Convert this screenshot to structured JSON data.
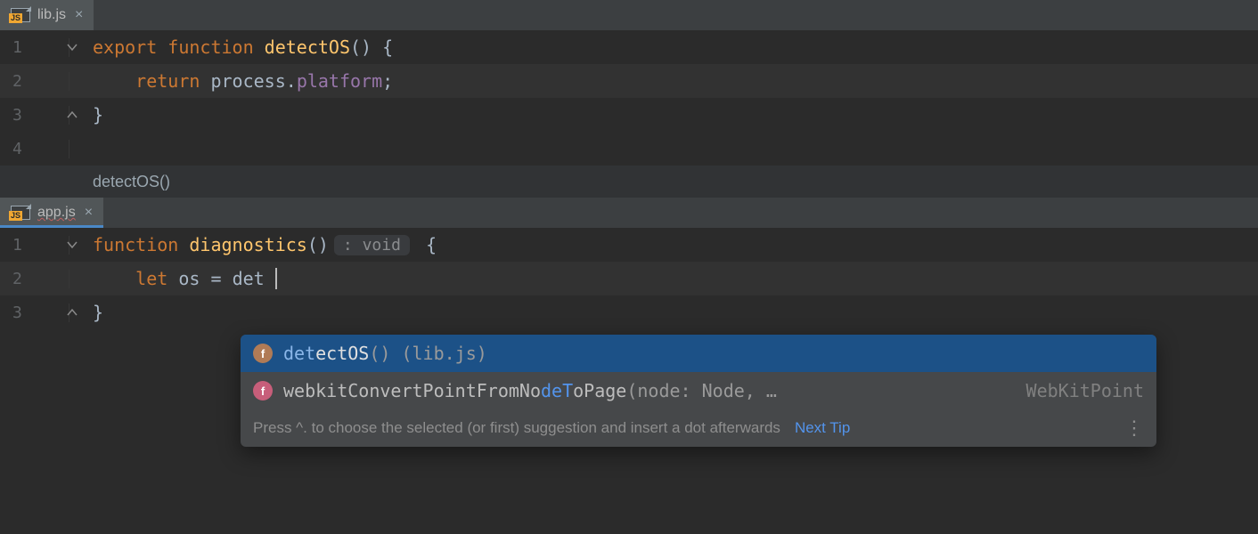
{
  "topPane": {
    "tab": {
      "filename": "lib.js"
    },
    "lines": [
      {
        "num": "1",
        "tokens": [
          {
            "cls": "kw",
            "t": "export"
          },
          {
            "cls": "punc",
            "t": " "
          },
          {
            "cls": "kw",
            "t": "function"
          },
          {
            "cls": "punc",
            "t": " "
          },
          {
            "cls": "fn",
            "t": "detectOS"
          },
          {
            "cls": "punc",
            "t": "()"
          },
          {
            "cls": "punc",
            "t": " "
          },
          {
            "cls": "punc",
            "t": "{"
          }
        ],
        "foldOpen": true
      },
      {
        "num": "2",
        "hl": true,
        "tokens": [
          {
            "cls": "punc",
            "t": "    "
          },
          {
            "cls": "kw",
            "t": "return"
          },
          {
            "cls": "punc",
            "t": " "
          },
          {
            "cls": "ident",
            "t": "process"
          },
          {
            "cls": "punc",
            "t": "."
          },
          {
            "cls": "prop",
            "t": "platform"
          },
          {
            "cls": "punc",
            "t": ";"
          }
        ]
      },
      {
        "num": "3",
        "tokens": [
          {
            "cls": "punc",
            "t": "}"
          }
        ],
        "foldClose": true
      },
      {
        "num": "4",
        "tokens": []
      }
    ],
    "breadcrumb": "detectOS()"
  },
  "bottomPane": {
    "tab": {
      "filename": "app.js"
    },
    "lines": [
      {
        "num": "1",
        "tokens": [
          {
            "cls": "kw",
            "t": "function"
          },
          {
            "cls": "punc",
            "t": " "
          },
          {
            "cls": "fn",
            "t": "diagnostics"
          },
          {
            "cls": "punc",
            "t": "()"
          },
          {
            "cls": "hint-box",
            "t": ": void"
          },
          {
            "cls": "punc",
            "t": " {"
          }
        ],
        "foldOpen": true
      },
      {
        "num": "2",
        "hl": true,
        "caret": true,
        "tokens": [
          {
            "cls": "punc",
            "t": "    "
          },
          {
            "cls": "kw",
            "t": "let"
          },
          {
            "cls": "punc",
            "t": " "
          },
          {
            "cls": "ident",
            "t": "os"
          },
          {
            "cls": "punc",
            "t": " = "
          },
          {
            "cls": "ident",
            "t": "det"
          }
        ]
      },
      {
        "num": "3",
        "tokens": [
          {
            "cls": "punc",
            "t": "}"
          }
        ],
        "foldClose": true
      }
    ]
  },
  "completion": {
    "items": [
      {
        "selected": true,
        "badge": "f",
        "badgeCls": "f-orange",
        "parts": [
          {
            "m": true,
            "t": "det"
          },
          {
            "m": false,
            "t": "ectOS"
          }
        ],
        "suffix": "()",
        "source": "(lib.js)",
        "tail": ""
      },
      {
        "selected": false,
        "badge": "f",
        "badgeCls": "f-pink",
        "parts": [
          {
            "m": false,
            "t": "webkitConvertPointFromNo"
          },
          {
            "m": true,
            "t": "deT"
          },
          {
            "m": false,
            "t": "oPage"
          }
        ],
        "suffix": "(node: Node, …",
        "source": "",
        "tail": "WebKitPoint"
      }
    ],
    "footerHint": "Press ^. to choose the selected (or first) suggestion and insert a dot afterwards",
    "footerLink": "Next Tip"
  }
}
